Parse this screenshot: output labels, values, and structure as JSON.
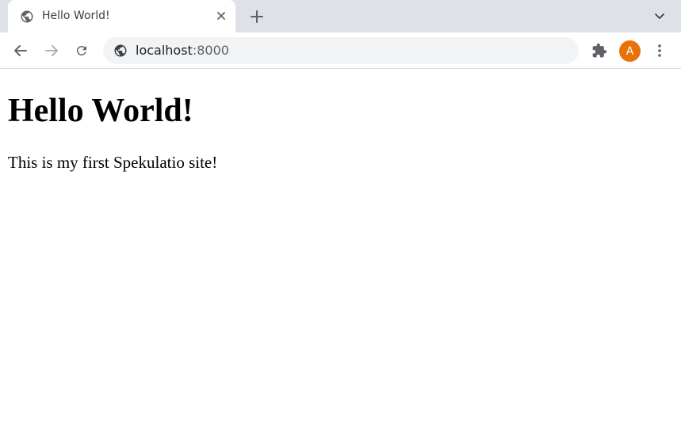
{
  "tab": {
    "title": "Hello World!",
    "favicon": "globe-icon"
  },
  "address_bar": {
    "host": "localhost",
    "port": ":8000",
    "site_info_icon": "globe-icon"
  },
  "profile": {
    "initial": "A",
    "color": "#e8710a"
  },
  "page": {
    "heading": "Hello World!",
    "paragraph": "This is my first Spekulatio site!"
  },
  "colors": {
    "tabstrip": "#dee1e6",
    "omnibox": "#f1f3f4",
    "icon": "#5f6368"
  }
}
